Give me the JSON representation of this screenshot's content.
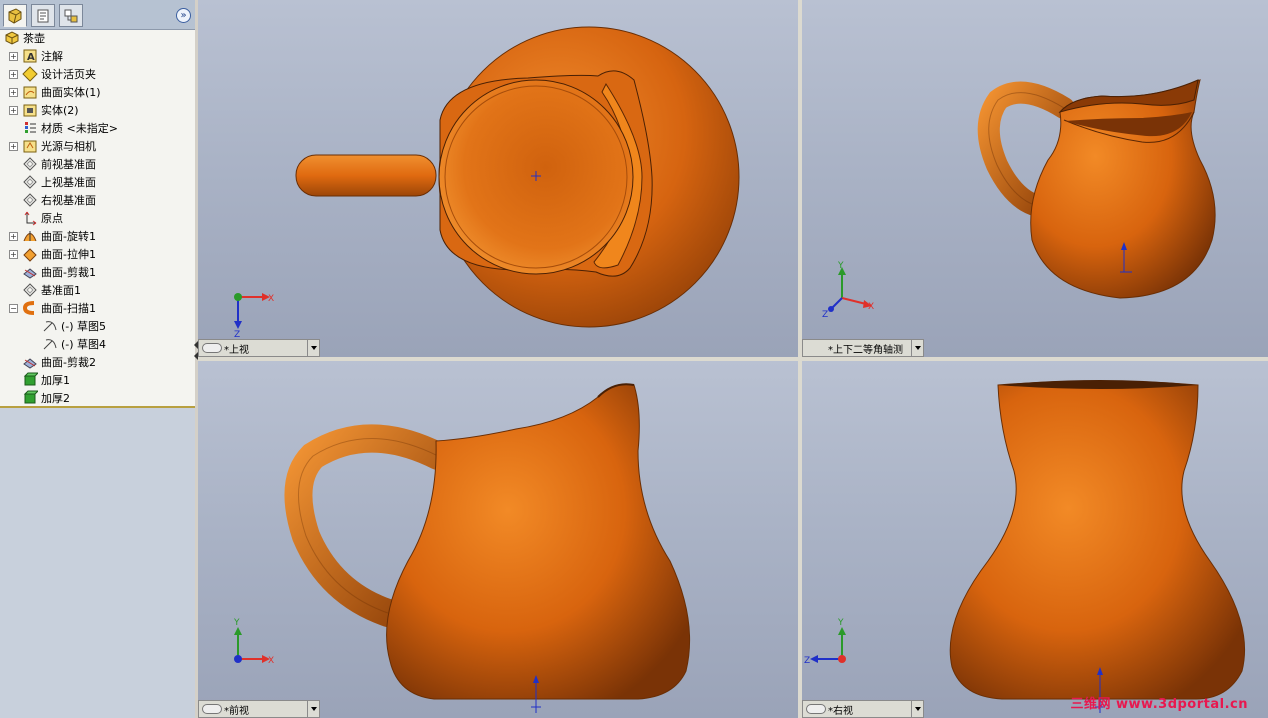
{
  "feature_tree": {
    "root_label": "茶壶",
    "items": [
      {
        "label": "注解",
        "icon": "annotation-icon",
        "expandable": true
      },
      {
        "label": "设计活页夹",
        "icon": "design-binder-icon",
        "expandable": true
      },
      {
        "label": "曲面实体(1)",
        "icon": "surface-bodies-icon",
        "expandable": true
      },
      {
        "label": "实体(2)",
        "icon": "solid-bodies-icon",
        "expandable": true
      },
      {
        "label": "材质 <未指定>",
        "icon": "material-icon",
        "expandable": false
      },
      {
        "label": "光源与相机",
        "icon": "lights-cameras-icon",
        "expandable": true
      },
      {
        "label": "前视基准面",
        "icon": "plane-icon",
        "expandable": false
      },
      {
        "label": "上视基准面",
        "icon": "plane-icon",
        "expandable": false
      },
      {
        "label": "右视基准面",
        "icon": "plane-icon",
        "expandable": false
      },
      {
        "label": "原点",
        "icon": "origin-icon",
        "expandable": false
      },
      {
        "label": "曲面-旋转1",
        "icon": "surface-revolve-icon",
        "expandable": true
      },
      {
        "label": "曲面-拉伸1",
        "icon": "surface-extrude-icon",
        "expandable": true
      },
      {
        "label": "曲面-剪裁1",
        "icon": "surface-trim-icon",
        "expandable": false
      },
      {
        "label": "基准面1",
        "icon": "plane-icon",
        "expandable": false
      },
      {
        "label": "曲面-扫描1",
        "icon": "surface-sweep-icon",
        "expandable": true,
        "expanded": true
      },
      {
        "label": "(-) 草图5",
        "icon": "sketch-icon",
        "expandable": false,
        "child": true
      },
      {
        "label": "(-) 草图4",
        "icon": "sketch-icon",
        "expandable": false,
        "child": true
      },
      {
        "label": "曲面-剪裁2",
        "icon": "surface-trim-icon",
        "expandable": false
      },
      {
        "label": "加厚1",
        "icon": "thicken-icon",
        "expandable": false
      },
      {
        "label": "加厚2",
        "icon": "thicken-icon",
        "expandable": false
      }
    ]
  },
  "viewports": {
    "top": {
      "label": "*上视"
    },
    "iso": {
      "label": "*上下二等角轴测"
    },
    "front": {
      "label": "*前视"
    },
    "right": {
      "label": "*右视"
    }
  },
  "axes": {
    "x": "X",
    "y": "Y",
    "z": "Z"
  },
  "colors": {
    "body": "#e06a10",
    "body_dark": "#7a3306",
    "accent_x": "#e0302a",
    "accent_y": "#2a9a2a",
    "accent_z": "#2030c8"
  },
  "watermark": "三维网 www.3dportal.cn"
}
